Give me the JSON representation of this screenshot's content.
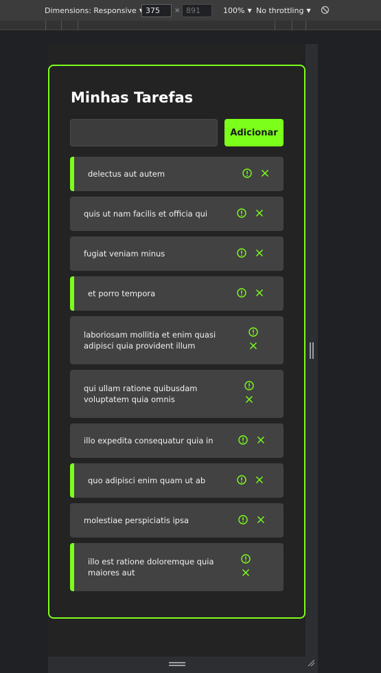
{
  "devtools": {
    "dimensions_label": "Dimensions: Responsive",
    "width_value": "375",
    "height_value": "891",
    "times": "×",
    "zoom": "100%",
    "throttling": "No throttling"
  },
  "app": {
    "title": "Minhas Tarefas",
    "input_value": "",
    "add_label": "Adicionar",
    "accent": "#7cff1b",
    "tasks": [
      {
        "text": "delectus aut autem",
        "important": true
      },
      {
        "text": "quis ut nam facilis et officia qui",
        "important": false
      },
      {
        "text": "fugiat veniam minus",
        "important": false
      },
      {
        "text": "et porro tempora",
        "important": true
      },
      {
        "text": "laboriosam mollitia et enim quasi adipisci quia provident illum",
        "important": false
      },
      {
        "text": "qui ullam ratione quibusdam voluptatem quia omnis",
        "important": false
      },
      {
        "text": "illo expedita consequatur quia in",
        "important": false
      },
      {
        "text": "quo adipisci enim quam ut ab",
        "important": true
      },
      {
        "text": "molestiae perspiciatis ipsa",
        "important": false
      },
      {
        "text": "illo est ratione doloremque quia maiores aut",
        "important": true
      }
    ]
  }
}
